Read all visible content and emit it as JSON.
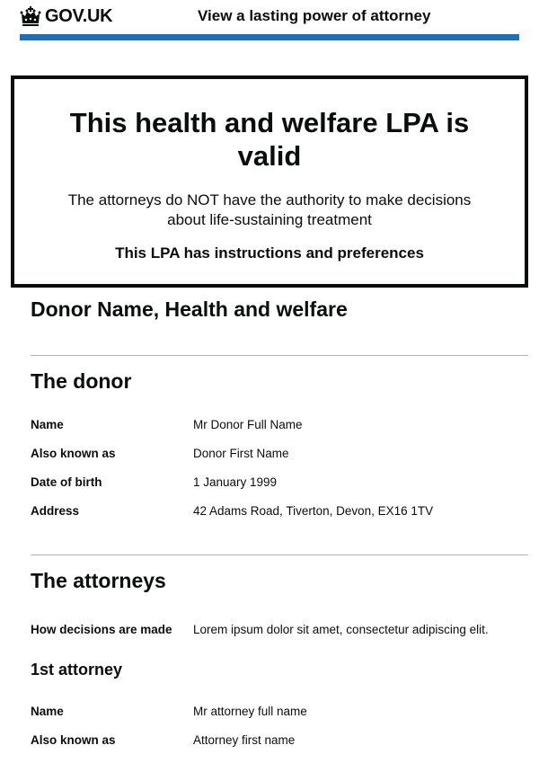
{
  "header": {
    "logo_icon": "crown-icon",
    "logo_text": "GOV.UK",
    "service_name": "View a lasting power of attorney",
    "bar_color": "#1d70b8"
  },
  "panel": {
    "title": "This health and welfare LPA is valid",
    "body": "The attorneys do NOT have the authority to make decisions about life-sustaining treatment",
    "strong": "This LPA has instructions and preferences"
  },
  "document": {
    "title": "Donor Name, Health and welfare"
  },
  "donor": {
    "heading": "The donor",
    "rows": [
      {
        "key": "Name",
        "value": "Mr Donor Full Name"
      },
      {
        "key": "Also known as",
        "value": "Donor First Name"
      },
      {
        "key": "Date of birth",
        "value": "1 January 1999"
      },
      {
        "key": "Address",
        "value": "42 Adams Road, Tiverton, Devon, EX16 1TV"
      }
    ]
  },
  "attorneys": {
    "heading": "The attorneys",
    "rows": [
      {
        "key": "How decisions are made",
        "value": "Lorem ipsum dolor sit amet, consectetur adipiscing elit."
      }
    ],
    "first_attorney": {
      "heading": "1st attorney",
      "rows": [
        {
          "key": "Name",
          "value": "Mr attorney full name"
        },
        {
          "key": "Also known as",
          "value": "Attorney first name"
        }
      ]
    }
  }
}
